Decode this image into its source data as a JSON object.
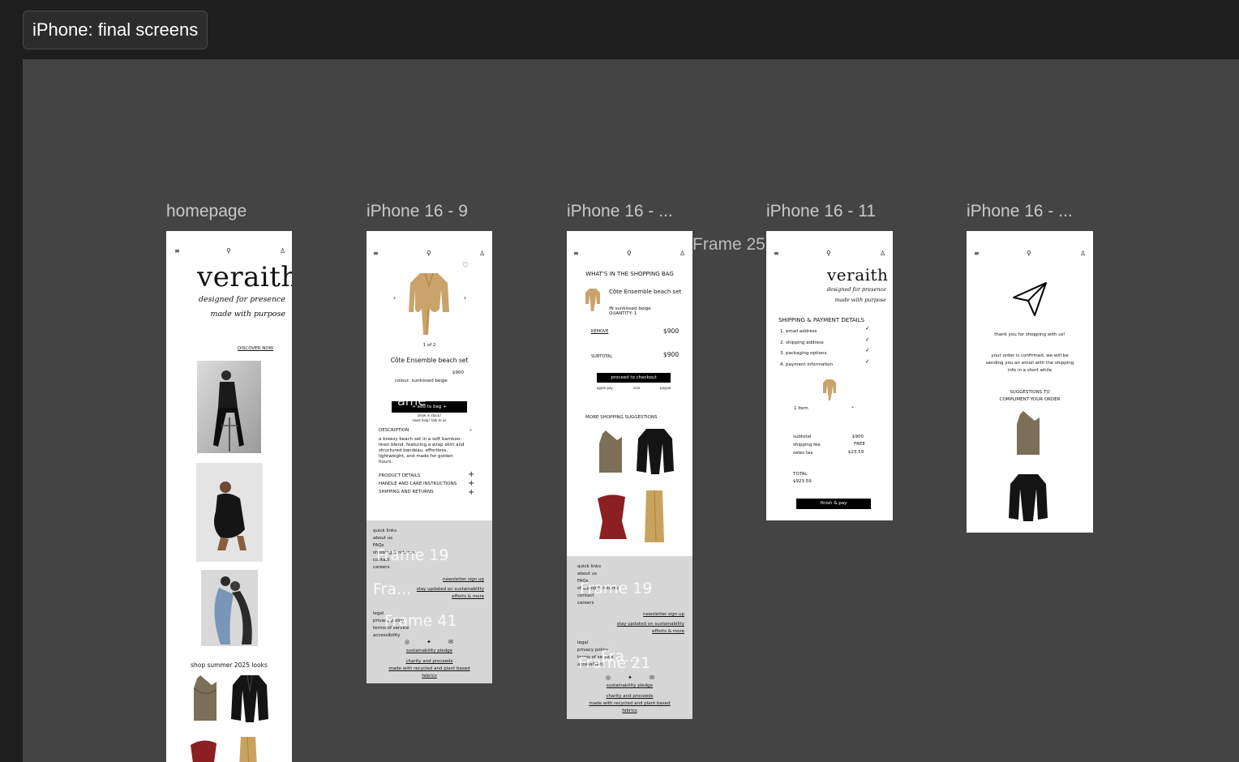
{
  "page_title": "iPhone: final screens",
  "frame_labels": {
    "homepage": "homepage",
    "product": "iPhone 16 - 9",
    "bag": "iPhone 16 - ...",
    "checkout": "iPhone 16 - 11",
    "confirm": "iPhone 16 - ...",
    "frame25": "Frame 25"
  },
  "nav": {
    "menu_icon": "≡",
    "search_icon": "⚲",
    "user_icon": "♙"
  },
  "brand": {
    "name": "veraith",
    "tagline1": "designed for presence",
    "tagline2": "made with purpose"
  },
  "homepage": {
    "discover": "DISCOVER NOW",
    "shop_heading": "shop summer 2025 looks"
  },
  "product": {
    "counter": "1 of 2",
    "name": "Côte Ensemble beach set",
    "price": "$900",
    "colour": "colour: sunkissed beige",
    "add_to_bag": "+ add to bag +",
    "stock": "show in stock?",
    "help": "need help? talk to us",
    "desc_heading": "DESCRIPTION",
    "desc_body": "a breezy beach set in a soft bamboo-linen blend, featuring a wrap skirt and structured bandeau. effortless, lightweight, and made for golden hours.",
    "accordions": [
      "PRODUCT DETAILS",
      "HANDLE AND CARE INSTRUCTIONS",
      "SHIPPING AND RETURNS"
    ],
    "ghost_labels": [
      "Frame 19",
      "Fra...",
      "Frame 41",
      "ame"
    ]
  },
  "footer": {
    "quick_links_heading": "quick links",
    "quick_links": [
      "about us",
      "FAQs",
      "shipping & returns",
      "contact",
      "careers"
    ],
    "newsletter": "newsletter sign up",
    "sustain1": "stay updated on sustainability",
    "sustain2": "efforts & more",
    "legal_heading": "legal",
    "legal_links": [
      "privacy policy",
      "terms of service",
      "accessibility"
    ],
    "social_icons": [
      "◎",
      "✦",
      "✉"
    ],
    "pledge": "sustainability pledge",
    "charity": "charity and proceeds",
    "fabrics1": "made with recycled and plant based",
    "fabrics2": "fabrics"
  },
  "bag": {
    "heading": "WHAT'S IN THE SHOPPING BAG",
    "item_name": "Côte Ensemble beach set",
    "item_colour": "IN sunkissed beige",
    "item_qty": "QUANTITY: 1",
    "remove": "REMOVE",
    "price": "$900",
    "subtotal_label": "SUBTOTAL",
    "subtotal": "$900",
    "checkout": "proceed to checkout",
    "pay_options": [
      "apple pay",
      "visa",
      "paypal"
    ],
    "suggestions": "MORE SHOPPING SUGGESTIONS",
    "ghost_labels": [
      "Frame 19",
      "Fra...",
      "Frame 21"
    ]
  },
  "checkout": {
    "heading": "SHIPPING & PAYMENT DETAILS",
    "steps": [
      "1. email address",
      "2. shipping address",
      "3. packaging options",
      "4. payment information"
    ],
    "items": "1 item",
    "subtotal_label": "subtotal",
    "subtotal": "$900",
    "shipping_label": "shipping fee",
    "shipping": "FREE",
    "tax_label": "sales tax",
    "tax": "$23.59",
    "total_label": "TOTAL",
    "total": "$923.59",
    "finish": "finish & pay"
  },
  "confirm": {
    "thanks": "thank you for shopping with us!",
    "line1": "your order is confirmed, we will be",
    "line2": "sending you an email with the shipping",
    "line3": "info in a short while",
    "sugg1": "SUGGESTIONS TO",
    "sugg2": "COMPLIMENT YOUR ORDER"
  }
}
